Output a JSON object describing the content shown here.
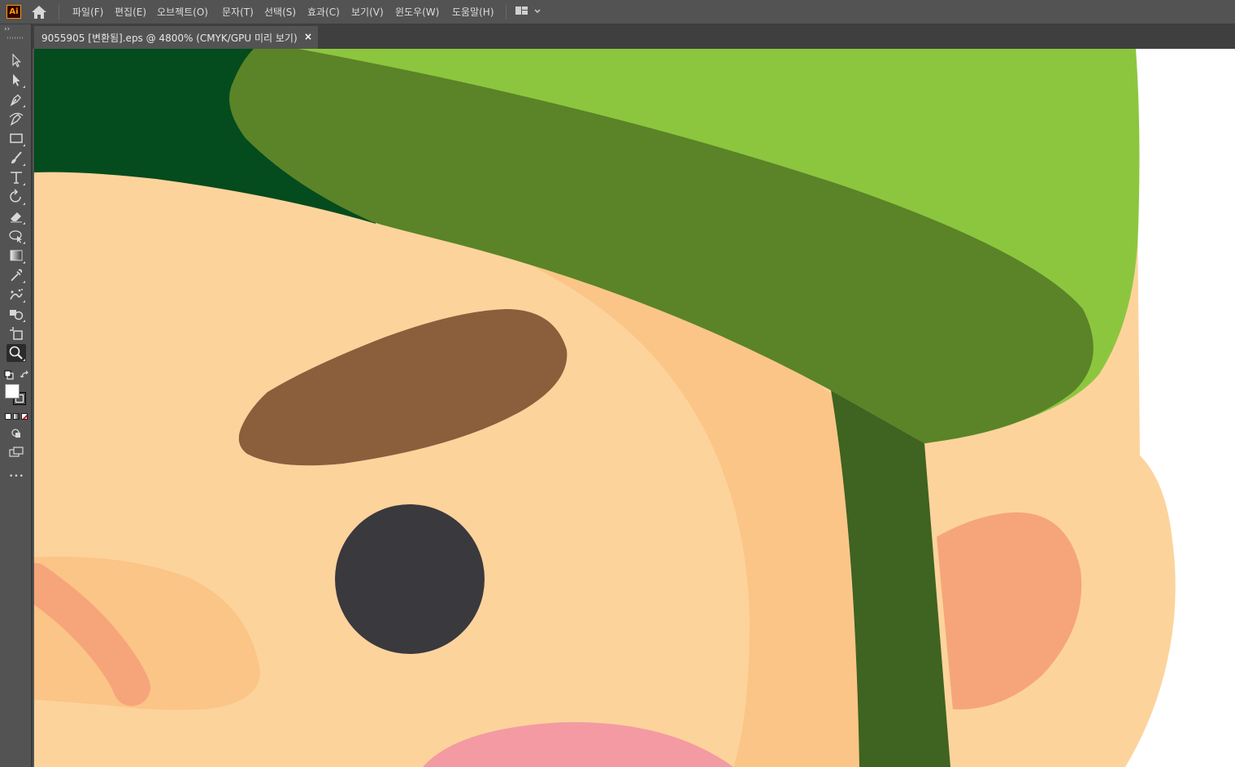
{
  "app": {
    "logo_text": "Ai",
    "accent": "#ff9a00"
  },
  "menu": {
    "items": [
      "파일(F)",
      "편집(E)",
      "오브젝트(O)",
      "문자(T)",
      "선택(S)",
      "효과(C)",
      "보기(V)",
      "윈도우(W)",
      "도움말(H)"
    ],
    "home_icon": "home-icon",
    "workspace_icon": "workspace-switcher-icon"
  },
  "document": {
    "tab_title": "9055905 [변환됨].eps @ 4800% (CMYK/GPU 미리 보기)",
    "close_glyph": "×"
  },
  "toolbar": {
    "collapse_glyph": "››",
    "more_glyph": "•••",
    "tools": [
      {
        "name": "selection-tool-icon"
      },
      {
        "name": "direct-selection-tool-icon"
      },
      {
        "name": "pen-tool-icon"
      },
      {
        "name": "curvature-tool-icon"
      },
      {
        "name": "rectangle-tool-icon"
      },
      {
        "name": "paintbrush-tool-icon"
      },
      {
        "name": "type-tool-icon"
      },
      {
        "name": "rotate-tool-icon"
      },
      {
        "name": "eraser-tool-icon"
      },
      {
        "name": "puppet-warp-tool-icon"
      },
      {
        "name": "gradient-tool-icon"
      },
      {
        "name": "eyedropper-tool-icon"
      },
      {
        "name": "symbol-sprayer-tool-icon"
      },
      {
        "name": "shape-builder-tool-icon"
      },
      {
        "name": "artboard-tool-icon"
      },
      {
        "name": "zoom-tool-icon",
        "active": true
      }
    ]
  },
  "colors": {
    "canvas_bg": "#ffffff",
    "cap_light": "#8cc63f",
    "cap_dark": "#5a8427",
    "cap_strap": "#3f6320",
    "hair_dark": "#044b1e",
    "cap_top_band": "#0f6e2e",
    "skin": "#fdd39c",
    "skin_shade": "#fbc587",
    "eyebrow": "#8b5e3c",
    "eye": "#3a393d",
    "ear_inner": "#f6a57a",
    "mouth": "#f49aa3"
  }
}
